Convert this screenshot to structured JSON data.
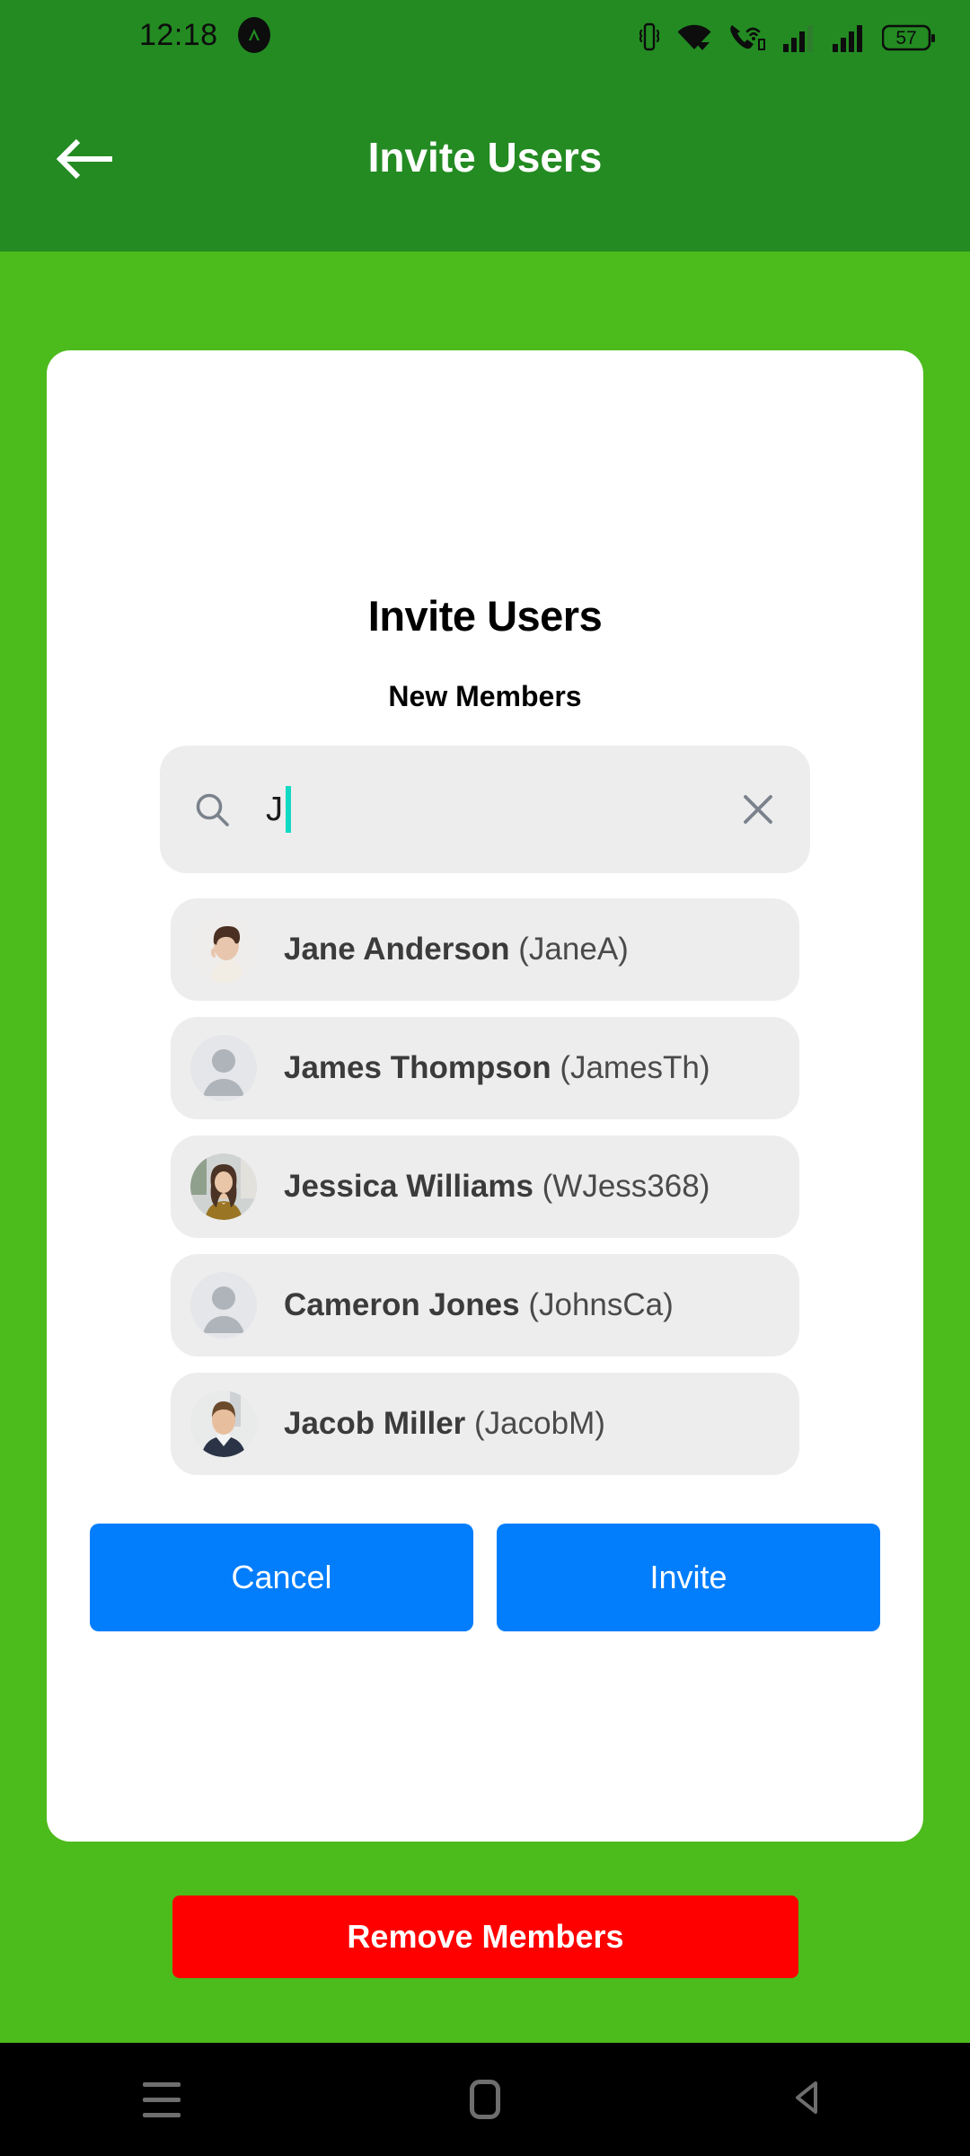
{
  "status_bar": {
    "time": "12:18",
    "app_icon": "caret-badge-icon",
    "icons": [
      "vibrate-icon",
      "wifi-icon",
      "wifi-calling-icon",
      "signal-bars-icon",
      "signal-bars-icon",
      "battery-icon"
    ],
    "battery_level": "57"
  },
  "app_bar": {
    "back_icon": "arrow-left-icon",
    "title": "Invite Users"
  },
  "dialog": {
    "title": "Invite Users",
    "subtitle": "New Members",
    "search": {
      "icon": "search-icon",
      "value": "J",
      "placeholder": "",
      "clear_icon": "close-icon",
      "caret_color": "#12D9C4"
    },
    "results": [
      {
        "name": "Jane Anderson",
        "handle": "(JaneA)",
        "avatar_type": "photo-woman-side"
      },
      {
        "name": "James Thompson",
        "handle": "(JamesTh)",
        "avatar_type": "placeholder-person"
      },
      {
        "name": "Jessica Williams",
        "handle": "(WJess368)",
        "avatar_type": "photo-woman-front"
      },
      {
        "name": "Cameron Jones",
        "handle": "(JohnsCa)",
        "avatar_type": "placeholder-person"
      },
      {
        "name": "Jacob Miller",
        "handle": "(JacobM)",
        "avatar_type": "photo-man-suit"
      }
    ],
    "cancel_label": "Cancel",
    "invite_label": "Invite"
  },
  "remove_members_label": "Remove Members",
  "nav_bar": {
    "recents_icon": "menu-icon",
    "home_icon": "home-square-icon",
    "back_icon": "back-triangle-icon"
  },
  "colors": {
    "status_bar_green": "#238B22",
    "body_green": "#4CBB1C",
    "card_white": "#FFFFFF",
    "field_gray": "#EDEDED",
    "primary_blue": "#027DFC",
    "danger_red": "#FF0000",
    "caret_teal": "#12D9C4"
  }
}
